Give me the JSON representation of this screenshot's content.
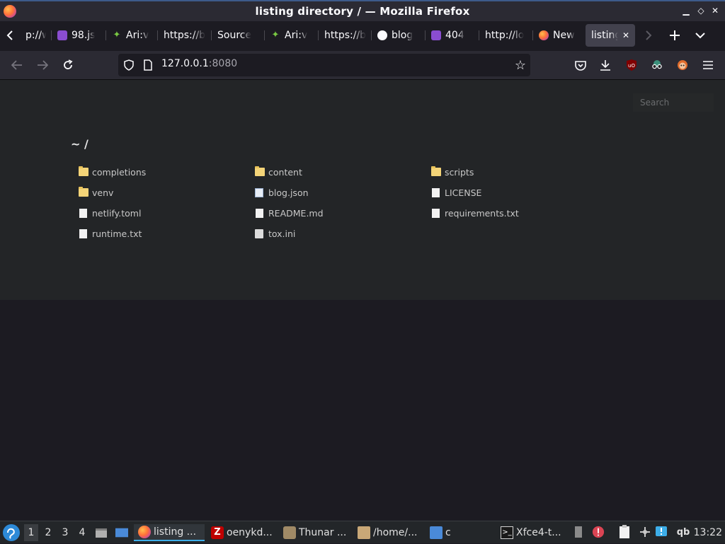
{
  "window": {
    "title": "listing directory / — Mozilla Firefox",
    "minimize": "▁",
    "maximize": "◇",
    "close": "✕"
  },
  "tabs": [
    {
      "label": "p://w",
      "favicon": "none"
    },
    {
      "label": "98.js",
      "favicon": "colorful-icon"
    },
    {
      "label": "Ari:v",
      "favicon": "leaf-icon"
    },
    {
      "label": "https://b",
      "favicon": "none"
    },
    {
      "label": "Source",
      "favicon": "none"
    },
    {
      "label": "Ari:v",
      "favicon": "leaf-icon"
    },
    {
      "label": "https://b",
      "favicon": "none"
    },
    {
      "label": "blog",
      "favicon": "github-icon"
    },
    {
      "label": "404",
      "favicon": "colorful-icon"
    },
    {
      "label": "http://lo",
      "favicon": "none"
    },
    {
      "label": "New",
      "favicon": "firefox-icon"
    },
    {
      "label": "listing",
      "favicon": "none",
      "active": true
    }
  ],
  "navbar": {
    "url_host": "127.0.0.1",
    "url_port": ":8080"
  },
  "page": {
    "search_placeholder": "Search",
    "heading": "~ /",
    "entries": [
      {
        "name": "completions",
        "type": "folder"
      },
      {
        "name": "content",
        "type": "folder"
      },
      {
        "name": "scripts",
        "type": "folder"
      },
      {
        "name": "venv",
        "type": "folder"
      },
      {
        "name": "blog.json",
        "type": "json"
      },
      {
        "name": "LICENSE",
        "type": "file"
      },
      {
        "name": "netlify.toml",
        "type": "file"
      },
      {
        "name": "README.md",
        "type": "file"
      },
      {
        "name": "requirements.txt",
        "type": "file"
      },
      {
        "name": "runtime.txt",
        "type": "file"
      },
      {
        "name": "tox.ini",
        "type": "ini"
      }
    ]
  },
  "taskbar": {
    "workspaces": [
      "1",
      "2",
      "3",
      "4"
    ],
    "apps": [
      {
        "label": "listing ...",
        "icon": "firefox-icon"
      },
      {
        "label": "oenykd...",
        "icon": "filezilla-icon"
      },
      {
        "label": "Thunar ...",
        "icon": "thunar-icon"
      },
      {
        "label": "/home/...",
        "icon": "archive-icon"
      },
      {
        "label": "c",
        "icon": "folder-icon"
      },
      {
        "label": "Xfce4-t...",
        "icon": "terminal-icon"
      }
    ],
    "clock": "13:22",
    "tray_qb": "qb"
  }
}
